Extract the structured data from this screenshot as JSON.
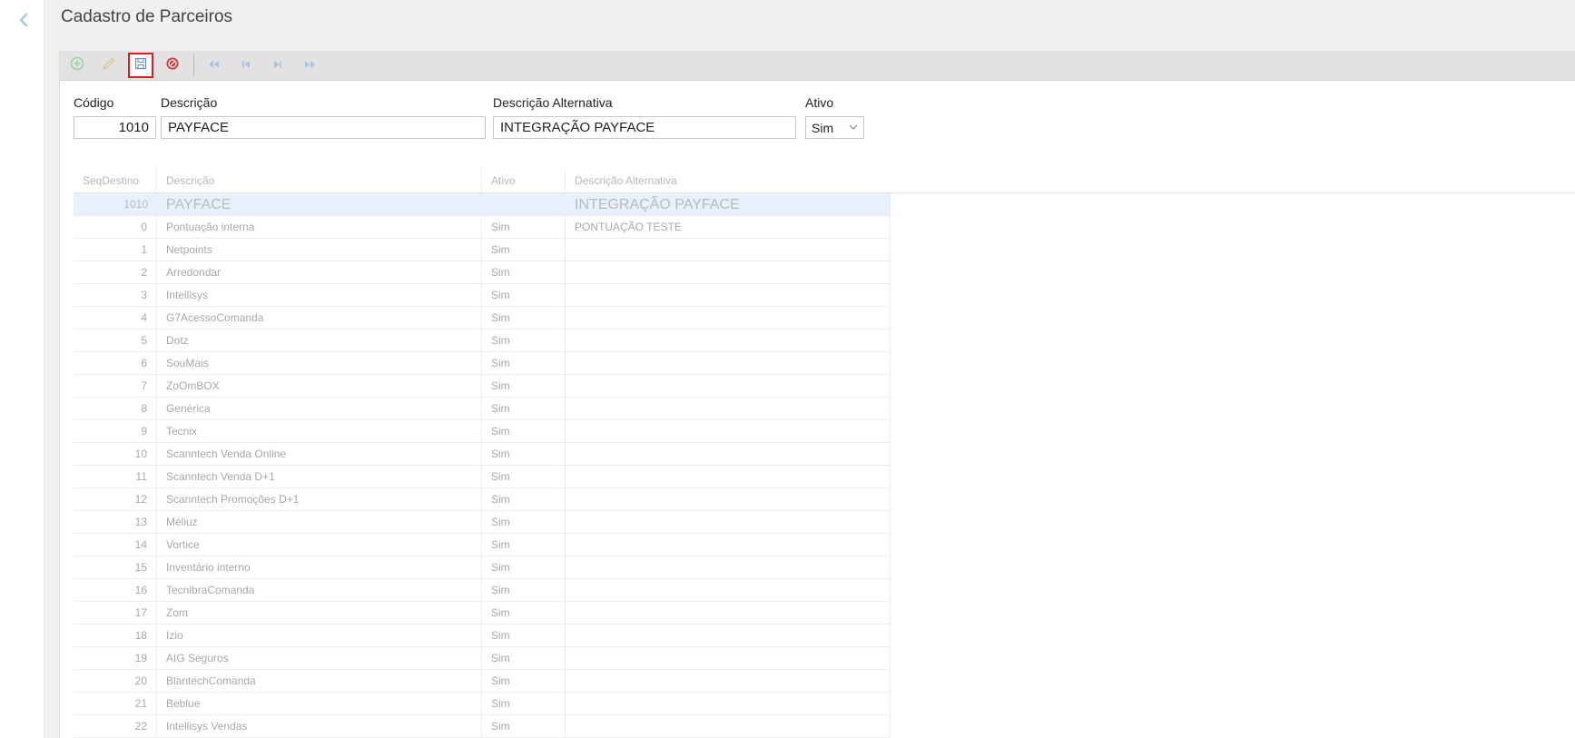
{
  "page": {
    "title": "Cadastro de Parceiros"
  },
  "form": {
    "codigo_label": "Código",
    "codigo_value": "1010",
    "descricao_label": "Descrição",
    "descricao_value": "PAYFACE",
    "desc_alt_label": "Descrição Alternativa",
    "desc_alt_value": "INTEGRAÇÃO PAYFACE",
    "ativo_label": "Ativo",
    "ativo_value": "Sim"
  },
  "grid": {
    "headers": [
      "SeqDestino",
      "Descrição",
      "Ativo",
      "Descrição Alternativa"
    ],
    "selected": {
      "seq": "1010",
      "descricao": "PAYFACE",
      "ativo": "",
      "desc_alt": "INTEGRAÇÃO PAYFACE"
    },
    "rows": [
      {
        "seq": "0",
        "descricao": "Pontuação interna",
        "ativo": "Sim",
        "desc_alt": "PONTUAÇÃO TESTE"
      },
      {
        "seq": "1",
        "descricao": "Netpoints",
        "ativo": "Sim",
        "desc_alt": ""
      },
      {
        "seq": "2",
        "descricao": "Arredondar",
        "ativo": "Sim",
        "desc_alt": ""
      },
      {
        "seq": "3",
        "descricao": "Intellisys",
        "ativo": "Sim",
        "desc_alt": ""
      },
      {
        "seq": "4",
        "descricao": "G7AcessoComanda",
        "ativo": "Sim",
        "desc_alt": ""
      },
      {
        "seq": "5",
        "descricao": "Dotz",
        "ativo": "Sim",
        "desc_alt": ""
      },
      {
        "seq": "6",
        "descricao": "SouMais",
        "ativo": "Sim",
        "desc_alt": ""
      },
      {
        "seq": "7",
        "descricao": "ZoOmBOX",
        "ativo": "Sim",
        "desc_alt": ""
      },
      {
        "seq": "8",
        "descricao": "Genérica",
        "ativo": "Sim",
        "desc_alt": ""
      },
      {
        "seq": "9",
        "descricao": "Tecnix",
        "ativo": "Sim",
        "desc_alt": ""
      },
      {
        "seq": "10",
        "descricao": "Scanntech Venda Online",
        "ativo": "Sim",
        "desc_alt": ""
      },
      {
        "seq": "11",
        "descricao": "Scanntech Venda D+1",
        "ativo": "Sim",
        "desc_alt": ""
      },
      {
        "seq": "12",
        "descricao": "Scanntech Promoções D+1",
        "ativo": "Sim",
        "desc_alt": ""
      },
      {
        "seq": "13",
        "descricao": "Méliuz",
        "ativo": "Sim",
        "desc_alt": ""
      },
      {
        "seq": "14",
        "descricao": "Vortice",
        "ativo": "Sim",
        "desc_alt": ""
      },
      {
        "seq": "15",
        "descricao": "Inventário interno",
        "ativo": "Sim",
        "desc_alt": ""
      },
      {
        "seq": "16",
        "descricao": "TecnibraComanda",
        "ativo": "Sim",
        "desc_alt": ""
      },
      {
        "seq": "17",
        "descricao": "Zom",
        "ativo": "Sim",
        "desc_alt": ""
      },
      {
        "seq": "18",
        "descricao": "Izio",
        "ativo": "Sim",
        "desc_alt": ""
      },
      {
        "seq": "19",
        "descricao": "AIG Seguros",
        "ativo": "Sim",
        "desc_alt": ""
      },
      {
        "seq": "20",
        "descricao": "BlantechComanda",
        "ativo": "Sim",
        "desc_alt": ""
      },
      {
        "seq": "21",
        "descricao": "Beblue",
        "ativo": "Sim",
        "desc_alt": ""
      },
      {
        "seq": "22",
        "descricao": "Intellisys Vendas",
        "ativo": "Sim",
        "desc_alt": ""
      }
    ]
  },
  "icons": {
    "back": "chevron-left-icon",
    "toolbar": [
      "add-icon",
      "edit-icon",
      "save-icon",
      "cancel-icon",
      "first-icon",
      "previous-icon",
      "next-icon",
      "last-icon"
    ]
  },
  "colors": {
    "accent": "#5aa8e0",
    "selected_outline": "#e21b1b",
    "cancel": "#d6373a",
    "add": "#7cc27c"
  }
}
